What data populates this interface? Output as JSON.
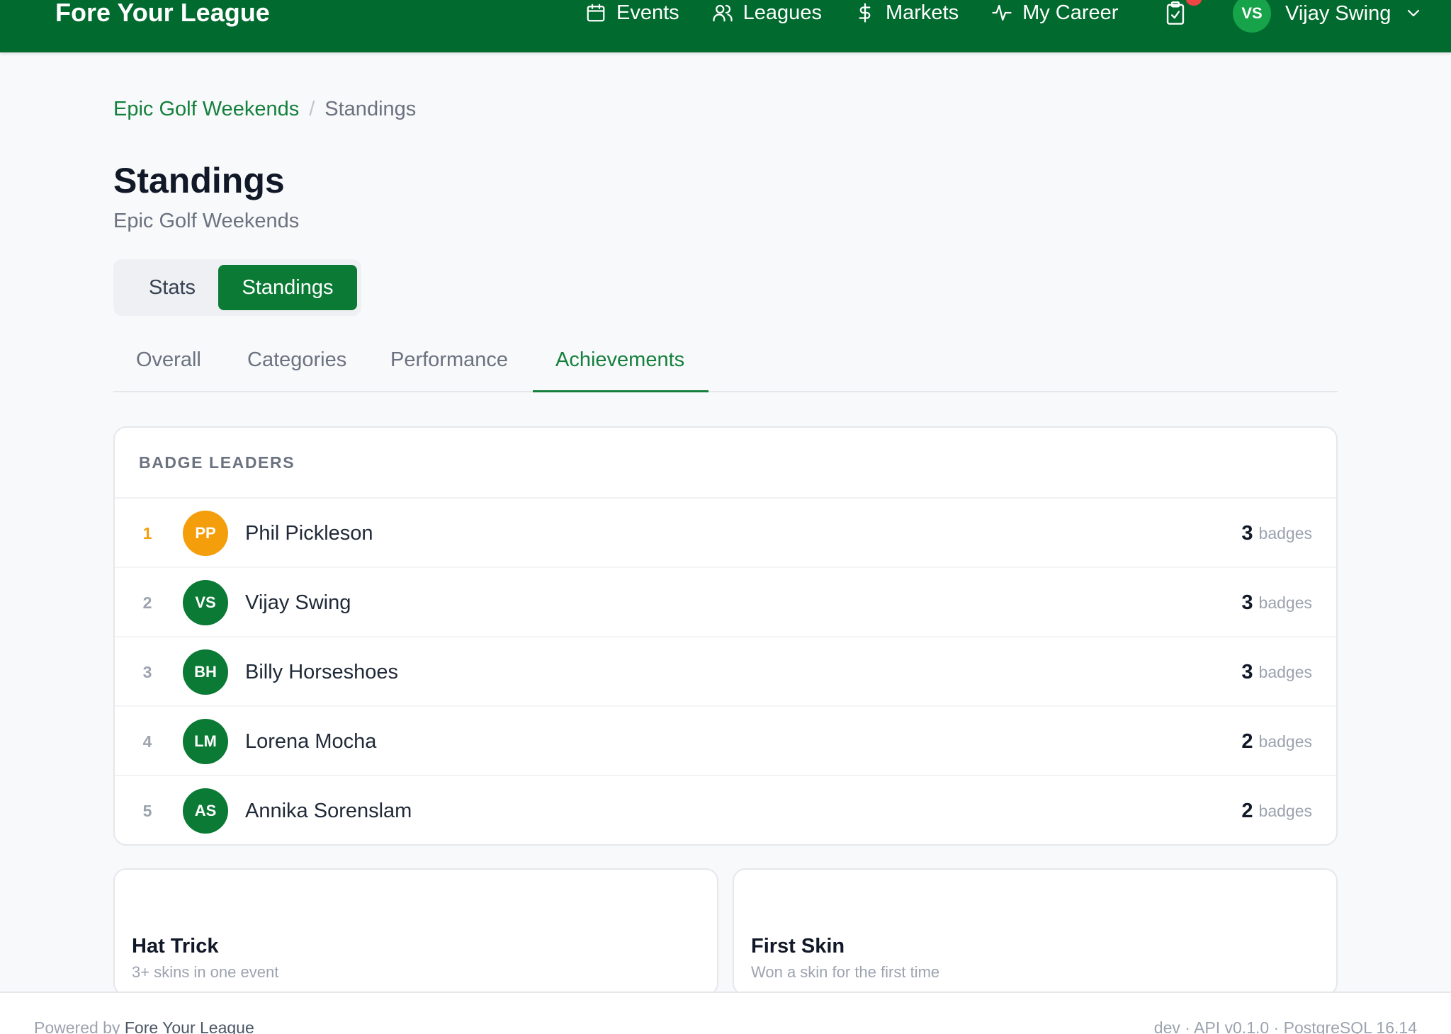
{
  "app": {
    "brand": "Fore Your League"
  },
  "nav": {
    "items": [
      {
        "label": "Events",
        "icon": "calendar-icon"
      },
      {
        "label": "Leagues",
        "icon": "users-icon"
      },
      {
        "label": "Markets",
        "icon": "dollar-icon"
      },
      {
        "label": "My Career",
        "icon": "activity-icon"
      }
    ],
    "tasks_icon": "clipboard-check-icon",
    "user": {
      "initials": "VS",
      "name": "Vijay Swing"
    }
  },
  "breadcrumb": {
    "parent": "Epic Golf Weekends",
    "separator": "/",
    "current": "Standings"
  },
  "page": {
    "title": "Standings",
    "subtitle": "Epic Golf Weekends"
  },
  "segment": {
    "options": [
      "Stats",
      "Standings"
    ],
    "selected": "Standings"
  },
  "tabs": {
    "items": [
      "Overall",
      "Categories",
      "Performance",
      "Achievements"
    ],
    "active": "Achievements"
  },
  "badge_leaders": {
    "heading": "BADGE LEADERS",
    "unit": "badges",
    "rows": [
      {
        "rank": "1",
        "initials": "PP",
        "name": "Phil Pickleson",
        "count": "3"
      },
      {
        "rank": "2",
        "initials": "VS",
        "name": "Vijay Swing",
        "count": "3"
      },
      {
        "rank": "3",
        "initials": "BH",
        "name": "Billy Horseshoes",
        "count": "3"
      },
      {
        "rank": "4",
        "initials": "LM",
        "name": "Lorena Mocha",
        "count": "2"
      },
      {
        "rank": "5",
        "initials": "AS",
        "name": "Annika Sorenslam",
        "count": "2"
      }
    ]
  },
  "achievements": [
    {
      "title": "Hat Trick",
      "description": "3+ skins in one event"
    },
    {
      "title": "First Skin",
      "description": "Won a skin for the first time"
    }
  ],
  "footer": {
    "powered_prefix": "Powered by",
    "powered_brand": "Fore Your League",
    "version": "dev · API v0.1.0 · PostgreSQL 16.14"
  },
  "colors": {
    "brand_green": "#016a2e",
    "accent_green": "#15803d",
    "gold": "#f59e0b",
    "notification": "#ef4444"
  }
}
